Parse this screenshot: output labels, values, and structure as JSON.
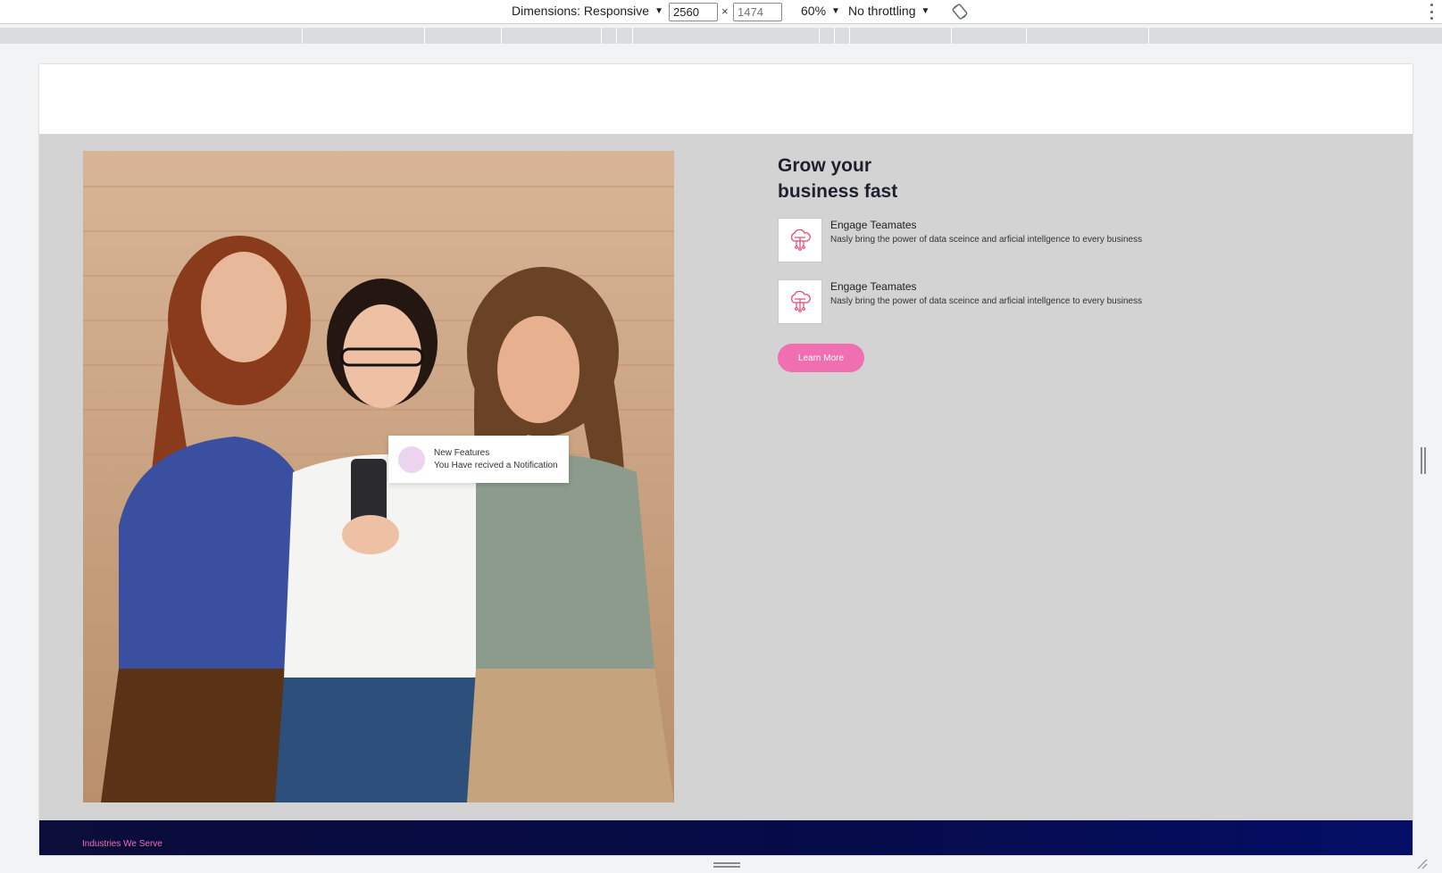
{
  "devtools": {
    "dimensions_label": "Dimensions: Responsive",
    "width_value": "2560",
    "height_placeholder": "1474",
    "times": "×",
    "zoom_label": "60%",
    "throttling_label": "No throttling",
    "caret": "▼",
    "icons": [
      "rotate-icon",
      "more-options-icon",
      "caret-down-icon"
    ]
  },
  "hero": {
    "title_line1": "Grow your",
    "title_line2": "business fast",
    "features": [
      {
        "title": "Engage Teamates",
        "description": "Nasly bring the power of data sceince and arficial intellgence to every business",
        "icon": "cloud-network-icon"
      },
      {
        "title": "Engage Teamates",
        "description": "Nasly bring the power of data sceince and arficial intellgence to every business",
        "icon": "cloud-network-icon"
      }
    ],
    "cta_label": "Learn More",
    "notification": {
      "title": "New Features",
      "message": "You Have recived a Notification"
    }
  },
  "industries": {
    "label": "Industries We Serve"
  },
  "colors": {
    "accent_pink": "#f06fb1",
    "hero_bg": "#d3d3d3",
    "navy": "#060b4a",
    "notif_dot": "#ecd4f0"
  }
}
